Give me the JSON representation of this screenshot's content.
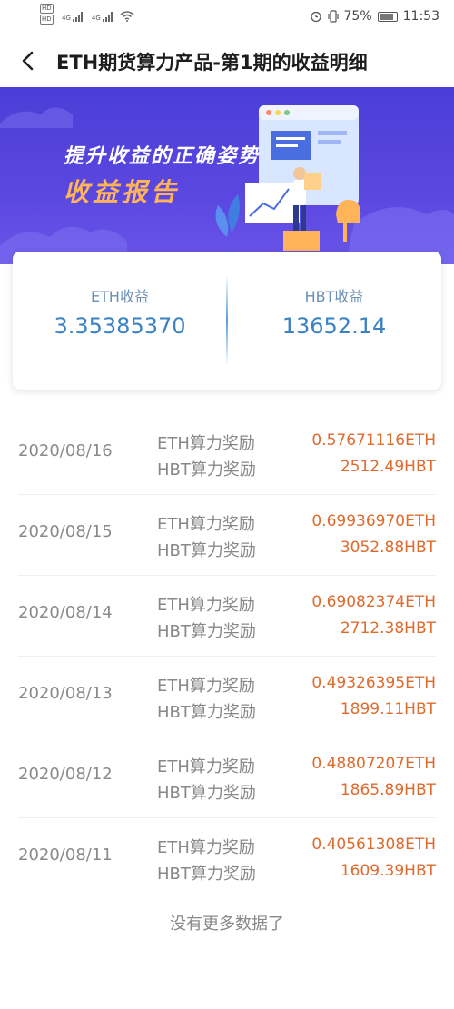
{
  "status_bar": {
    "hd1": "HD",
    "hd2": "HD",
    "net1": "4G",
    "net2": "4G",
    "battery_percent": "75%",
    "time": "11:53"
  },
  "header": {
    "title": "ETH期货算力产品-第1期的收益明细"
  },
  "banner": {
    "slogan_line1": "提升收益的正确姿势",
    "slogan_line2": "收益报告"
  },
  "summary": {
    "eth_label": "ETH收益",
    "eth_value": "3.35385370",
    "hbt_label": "HBT收益",
    "hbt_value": "13652.14"
  },
  "records": [
    {
      "date": "2020/08/16",
      "label1": "ETH算力奖励",
      "value1": "0.57671116ETH",
      "label2": "HBT算力奖励",
      "value2": "2512.49HBT"
    },
    {
      "date": "2020/08/15",
      "label1": "ETH算力奖励",
      "value1": "0.69936970ETH",
      "label2": "HBT算力奖励",
      "value2": "3052.88HBT"
    },
    {
      "date": "2020/08/14",
      "label1": "ETH算力奖励",
      "value1": "0.69082374ETH",
      "label2": "HBT算力奖励",
      "value2": "2712.38HBT"
    },
    {
      "date": "2020/08/13",
      "label1": "ETH算力奖励",
      "value1": "0.49326395ETH",
      "label2": "HBT算力奖励",
      "value2": "1899.11HBT"
    },
    {
      "date": "2020/08/12",
      "label1": "ETH算力奖励",
      "value1": "0.48807207ETH",
      "label2": "HBT算力奖励",
      "value2": "1865.89HBT"
    },
    {
      "date": "2020/08/11",
      "label1": "ETH算力奖励",
      "value1": "0.40561308ETH",
      "label2": "HBT算力奖励",
      "value2": "1609.39HBT"
    }
  ],
  "footer": {
    "no_more": "没有更多数据了"
  },
  "colors": {
    "accent_blue": "#3a82c4",
    "value_orange": "#e06a2c",
    "banner_purple": "#4a3ed6",
    "slogan_orange": "#ffb45a"
  }
}
